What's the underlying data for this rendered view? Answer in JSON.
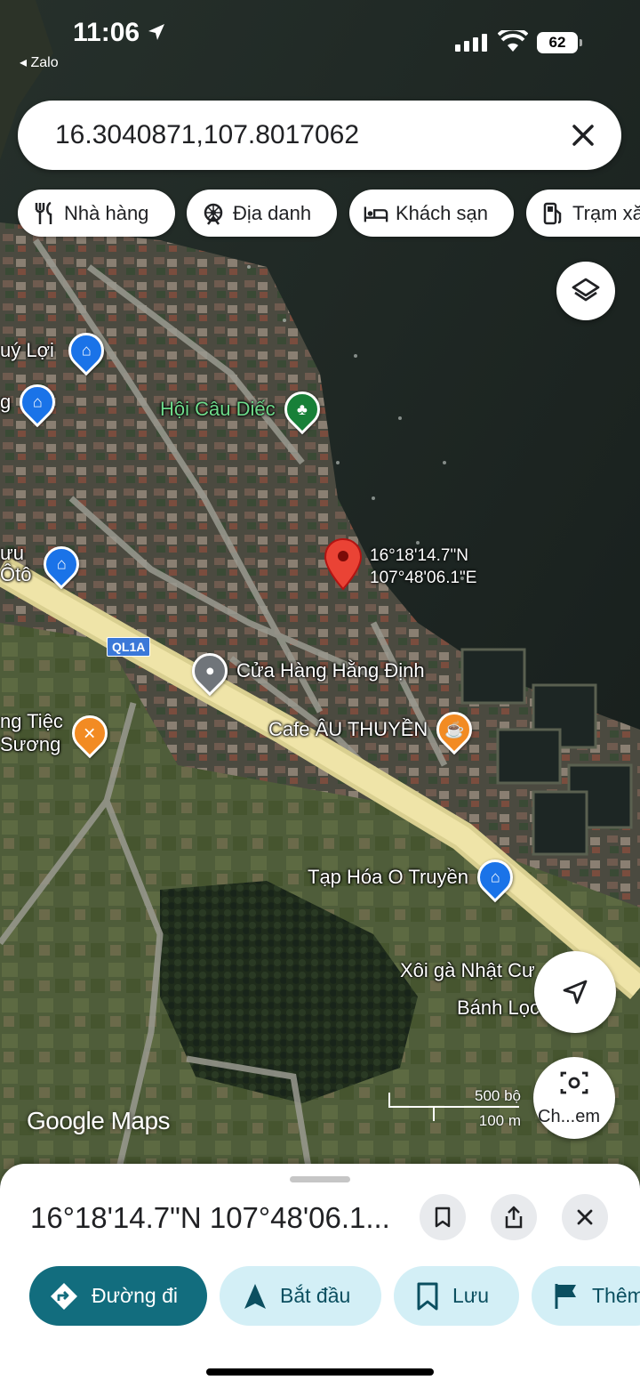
{
  "status_bar": {
    "time": "11:06",
    "back_app": "◂ Zalo",
    "battery": "62"
  },
  "search": {
    "value": "16.3040871,107.8017062"
  },
  "chips": [
    {
      "label": "Nhà hàng",
      "icon": "restaurant-icon"
    },
    {
      "label": "Địa danh",
      "icon": "landmark-icon"
    },
    {
      "label": "Khách sạn",
      "icon": "hotel-icon"
    },
    {
      "label": "Trạm xă",
      "icon": "gas-station-icon"
    }
  ],
  "map": {
    "pois": [
      {
        "label": "uý Lợi",
        "category": "shopping",
        "color": "#1a73e8"
      },
      {
        "label": "g",
        "category": "shopping",
        "color": "#1a73e8"
      },
      {
        "label": "Hội Câu Diếc",
        "category": "park",
        "color": "#188038"
      },
      {
        "label": "ưu\nÔtô",
        "category": "shopping",
        "color": "#1a73e8"
      },
      {
        "label": "Cửa Hàng Hằng Định",
        "category": "place",
        "color": "#70757a"
      },
      {
        "label": "ng Tiệc\nSương",
        "category": "restaurant",
        "color": "#f28b23"
      },
      {
        "label": "Cafe ÂU THUYỀN",
        "category": "cafe",
        "color": "#f28b23"
      },
      {
        "label": "Tạp Hóa O Truyền",
        "category": "shopping",
        "color": "#1a73e8"
      },
      {
        "label": "Xôi gà Nhật Cư",
        "category": "restaurant",
        "color": "#f28b23"
      },
      {
        "label": "Bánh Lọc",
        "category": "restaurant",
        "color": "#f28b23"
      }
    ],
    "road_shield": "QL1A",
    "dropped_pin": {
      "lat": "16°18'14.7\"N",
      "lng": "107°48'06.1\"E"
    },
    "watermark": "Google Maps",
    "scale": {
      "imperial": "500 bộ",
      "metric": "100 m"
    }
  },
  "fabs": {
    "layers": "layers-icon",
    "my_location": "navigation-arrow-icon",
    "lens_label": "Ch...em"
  },
  "sheet": {
    "title": "16°18'14.7\"N 107°48'06.1...",
    "actions": [
      {
        "label": "Đường đi",
        "icon": "directions-icon"
      },
      {
        "label": "Bắt đầu",
        "icon": "navigation-icon"
      },
      {
        "label": "Lưu",
        "icon": "bookmark-icon"
      },
      {
        "label": "Thêm",
        "icon": "flag-icon"
      }
    ]
  },
  "colors": {
    "primary_action": "#126d7e",
    "tonal_action": "#d3eff6",
    "pin_red": "#ea4335"
  }
}
